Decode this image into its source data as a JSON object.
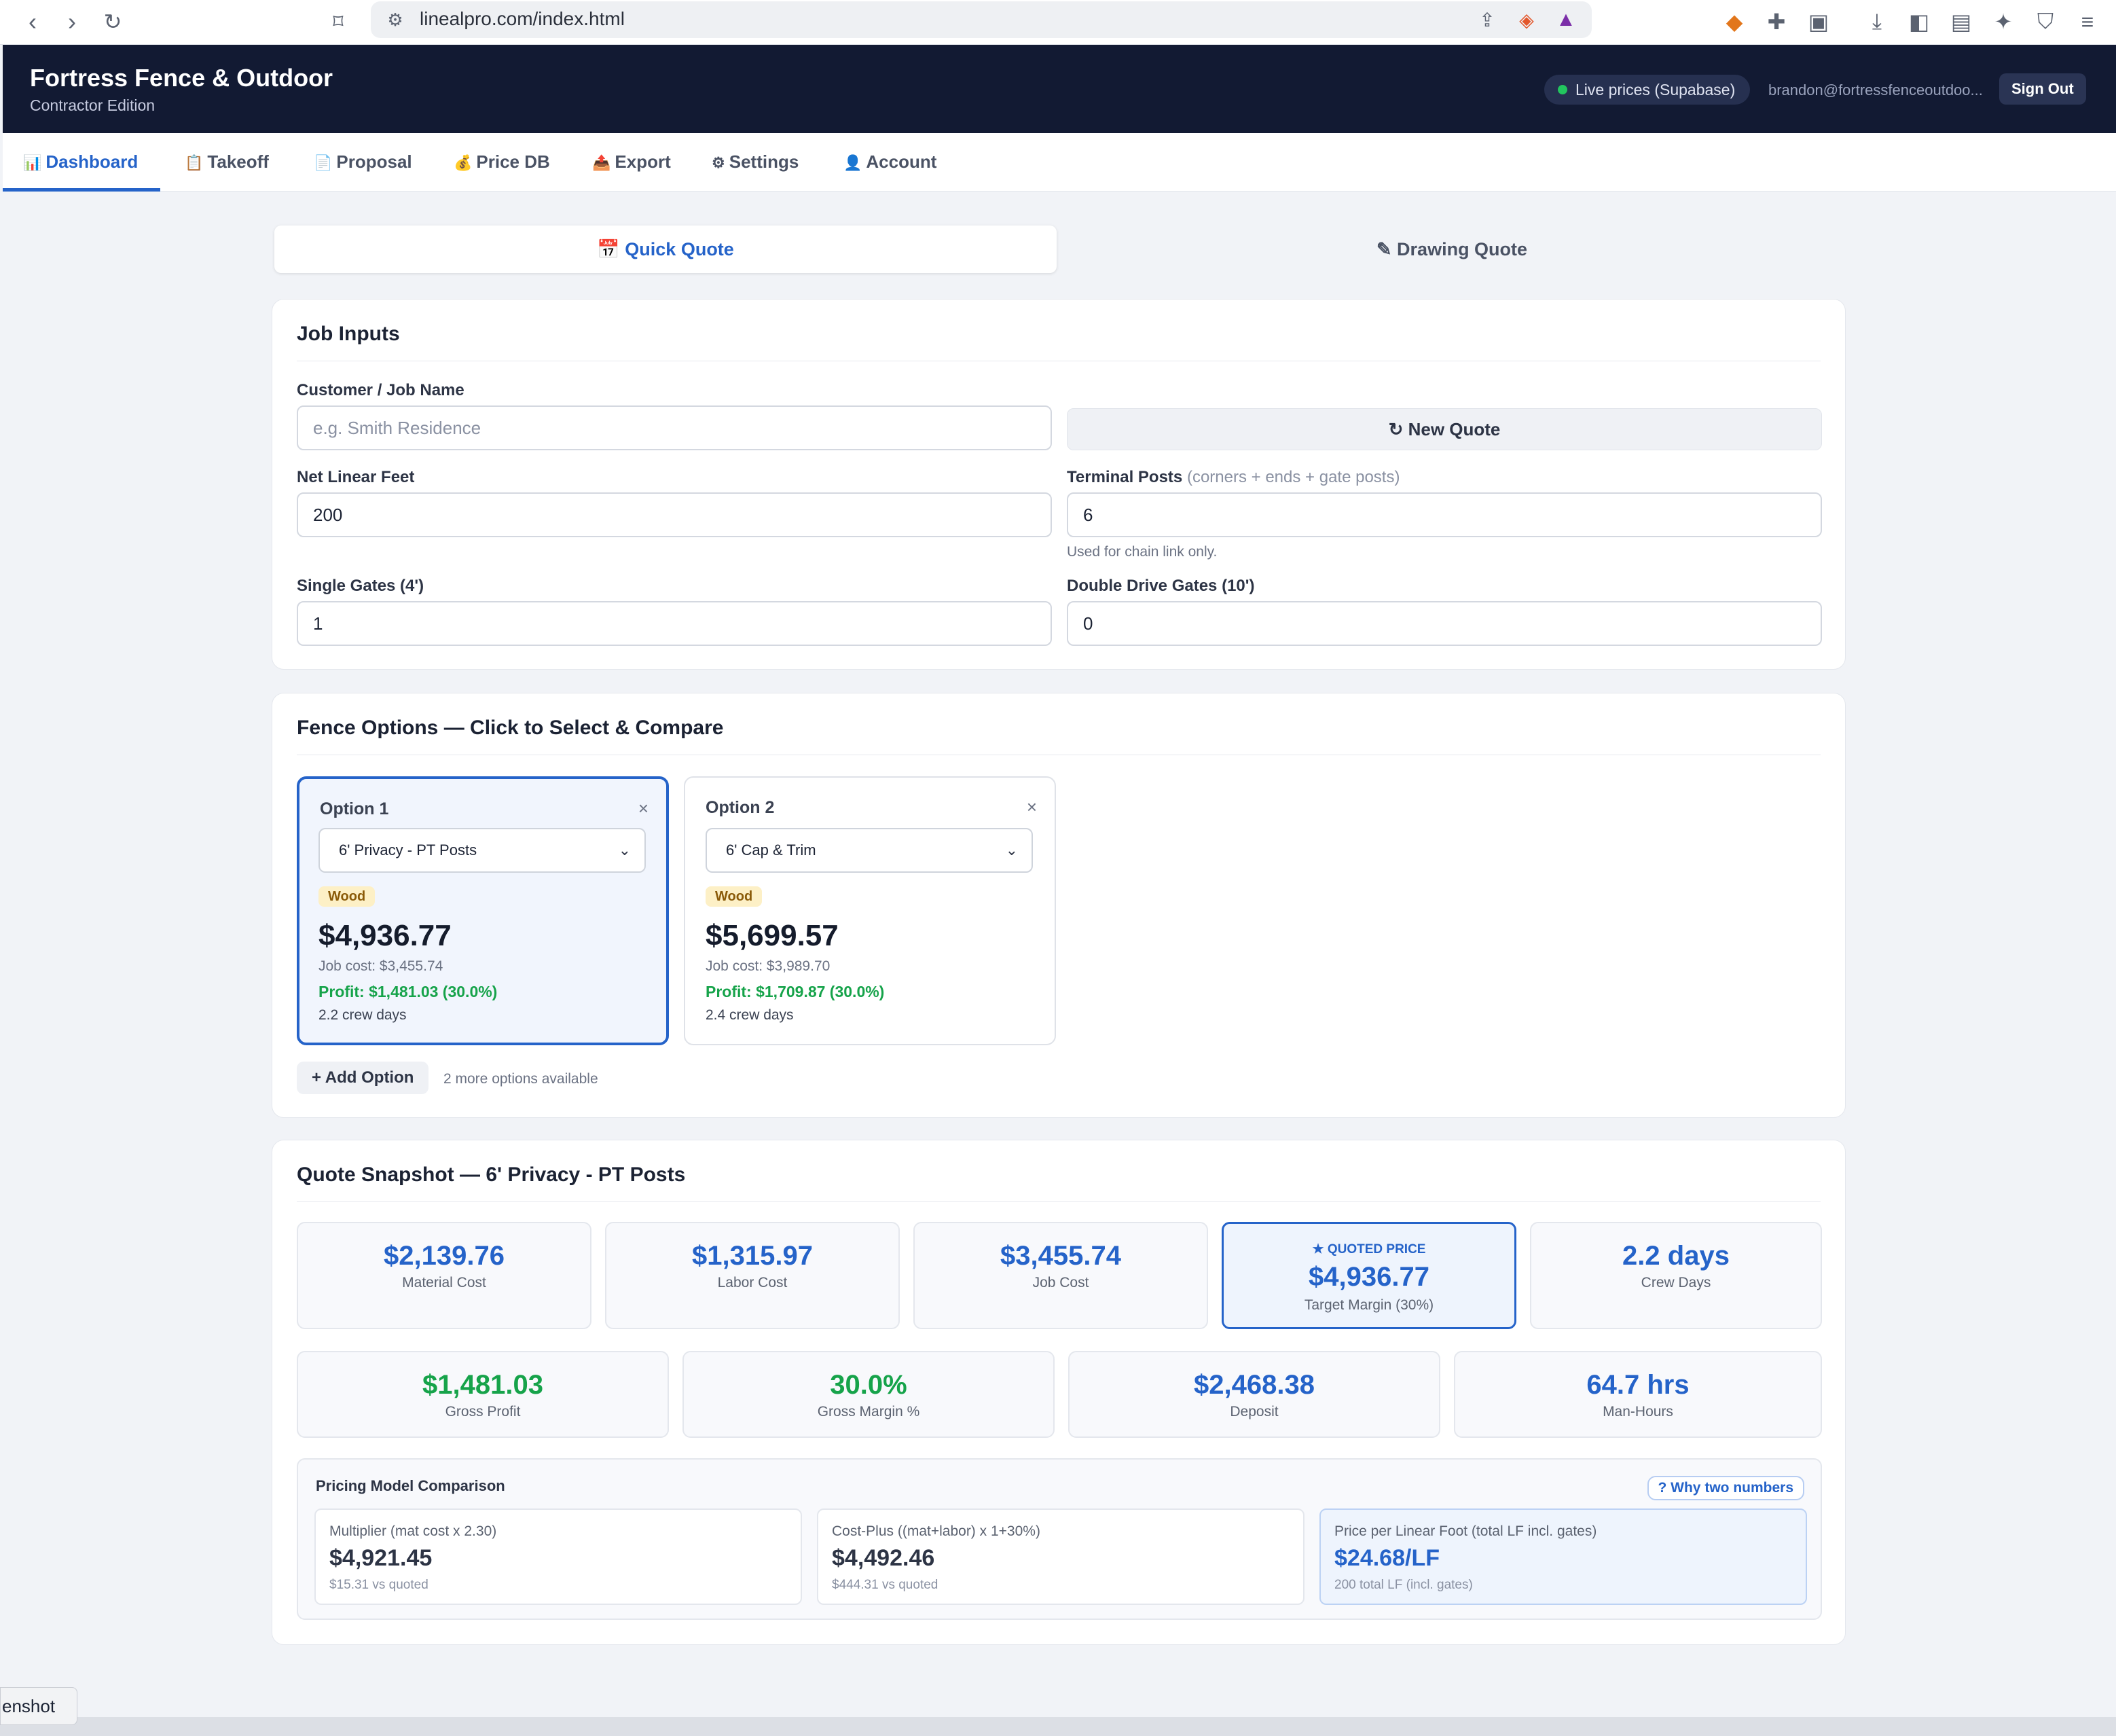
{
  "browser": {
    "url": "linealpro.com/index.html"
  },
  "header": {
    "title": "Fortress Fence & Outdoor",
    "subtitle": "Contractor Edition",
    "live_status": "Live prices (Supabase)",
    "user_email": "brandon@fortressfenceoutdoo...",
    "sign_out": "Sign Out"
  },
  "tabs": [
    {
      "icon": "📊",
      "label": "Dashboard"
    },
    {
      "icon": "📋",
      "label": "Takeoff"
    },
    {
      "icon": "📄",
      "label": "Proposal"
    },
    {
      "icon": "💰",
      "label": "Price DB"
    },
    {
      "icon": "📤",
      "label": "Export"
    },
    {
      "icon": "⚙",
      "label": "Settings"
    },
    {
      "icon": "👤",
      "label": "Account"
    }
  ],
  "modes": {
    "quick": "📅 Quick Quote",
    "drawing": "✎ Drawing Quote"
  },
  "job_inputs": {
    "title": "Job Inputs",
    "customer_label": "Customer / Job Name",
    "customer_placeholder": "e.g. Smith Residence",
    "new_quote": "↻ New Quote",
    "net_lf_label": "Net Linear Feet",
    "net_lf_value": "200",
    "terminal_label": "Terminal Posts",
    "terminal_hint": "(corners + ends + gate posts)",
    "terminal_value": "6",
    "terminal_note": "Used for chain link only.",
    "single_gates_label": "Single Gates (4')",
    "single_gates_value": "1",
    "double_gates_label": "Double Drive Gates (10')",
    "double_gates_value": "0"
  },
  "fence_options": {
    "title": "Fence Options — Click to Select & Compare",
    "options": [
      {
        "name": "Option 1",
        "close": "×",
        "select": "6' Privacy - PT Posts",
        "badge": "Wood",
        "price": "$4,936.77",
        "job_cost": "Job cost: $3,455.74",
        "profit": "Profit: $1,481.03 (30.0%)",
        "crew": "2.2 crew days"
      },
      {
        "name": "Option 2",
        "close": "×",
        "select": "6' Cap & Trim",
        "badge": "Wood",
        "price": "$5,699.57",
        "job_cost": "Job cost: $3,989.70",
        "profit": "Profit: $1,709.87 (30.0%)",
        "crew": "2.4 crew days"
      }
    ],
    "add_option": "+ Add Option",
    "more_available": "2 more options available"
  },
  "snapshot": {
    "title": "Quote Snapshot — 6' Privacy - PT Posts",
    "row1": [
      {
        "value": "$2,139.76",
        "label": "Material Cost"
      },
      {
        "value": "$1,315.97",
        "label": "Labor Cost"
      },
      {
        "value": "$3,455.74",
        "label": "Job Cost"
      },
      {
        "tag": "★ QUOTED PRICE",
        "value": "$4,936.77",
        "label": "Target Margin (30%)"
      },
      {
        "value": "2.2 days",
        "label": "Crew Days"
      }
    ],
    "row2": [
      {
        "value": "$1,481.03",
        "label": "Gross Profit"
      },
      {
        "value": "30.0%",
        "label": "Gross Margin %"
      },
      {
        "value": "$2,468.38",
        "label": "Deposit"
      },
      {
        "value": "64.7 hrs",
        "label": "Man-Hours"
      }
    ],
    "pricing": {
      "title": "Pricing Model Comparison",
      "why": "? Why two numbers",
      "models": [
        {
          "label": "Multiplier (mat cost x 2.30)",
          "value": "$4,921.45",
          "sub": "$15.31 vs quoted"
        },
        {
          "label": "Cost-Plus ((mat+labor) x 1+30%)",
          "value": "$4,492.46",
          "sub": "$444.31 vs quoted"
        },
        {
          "label": "Price per Linear Foot (total LF incl. gates)",
          "value": "$24.68/LF",
          "sub": "200 total LF (incl. gates)"
        }
      ]
    }
  },
  "screenshot_tip": "enshot",
  "colors": {
    "accent": "#2563c9",
    "header_bg": "#121a33",
    "profit_green": "#16a34a"
  }
}
